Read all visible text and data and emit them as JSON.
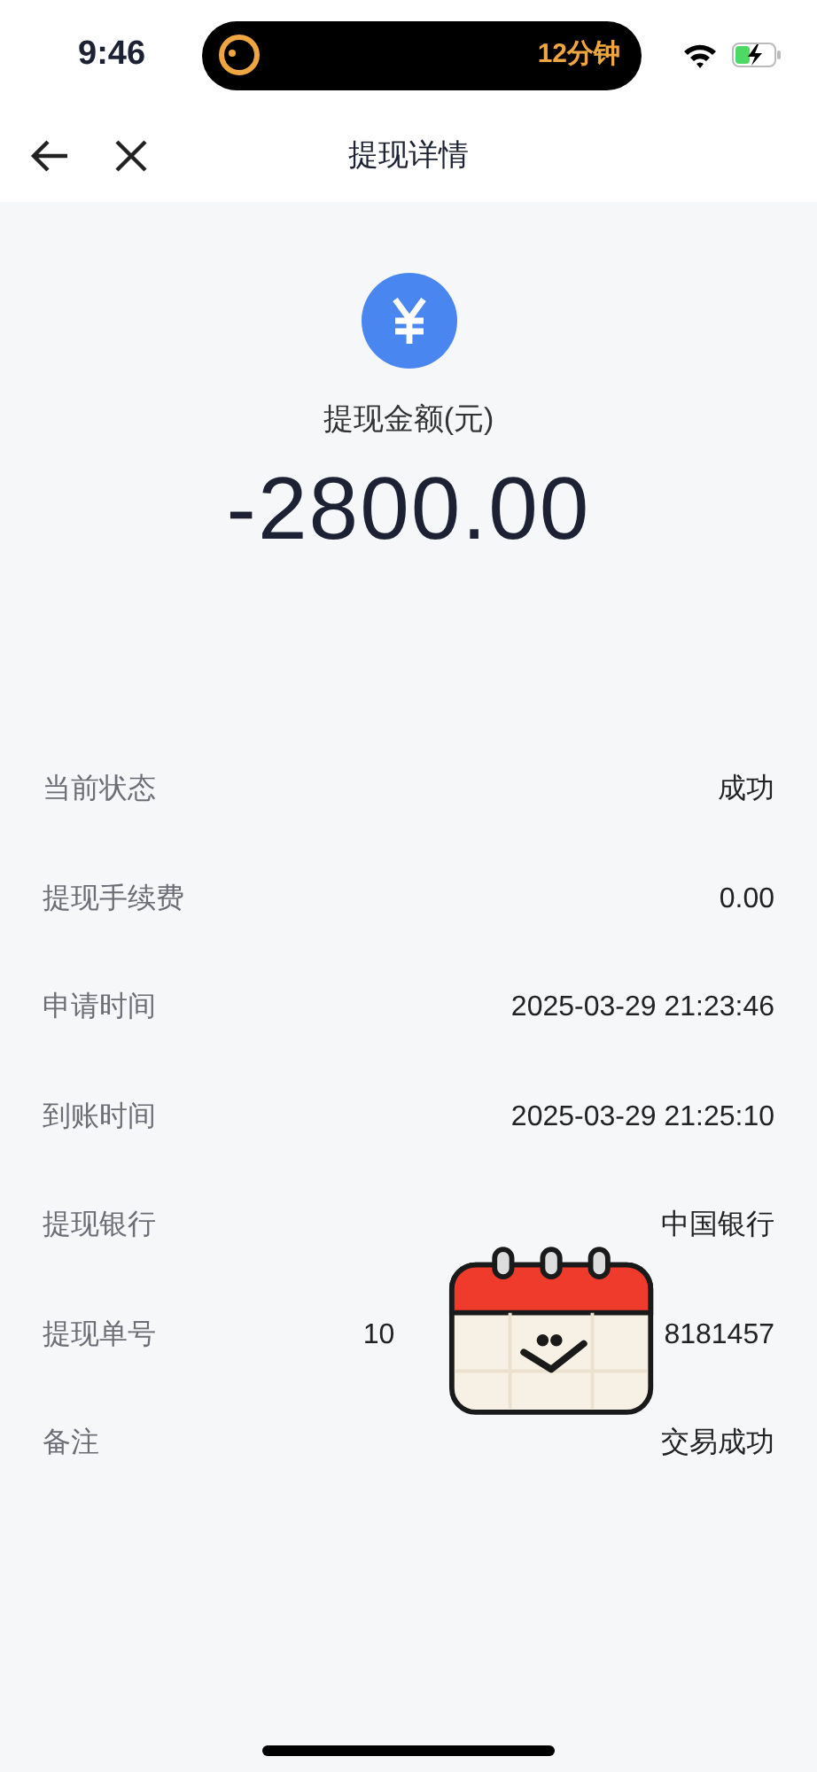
{
  "status_bar": {
    "time": "9:46",
    "island_text": "12分钟"
  },
  "nav": {
    "title": "提现详情"
  },
  "summary": {
    "label": "提现金额(元)",
    "amount": "-2800.00"
  },
  "details": [
    {
      "label": "当前状态",
      "value": [
        "成功"
      ]
    },
    {
      "label": "提现手续费",
      "value": [
        "0.00"
      ]
    },
    {
      "label": "申请时间",
      "value": [
        "2025-03-29 21:23:46"
      ]
    },
    {
      "label": "到账时间",
      "value": [
        "2025-03-29 21:25:10"
      ]
    },
    {
      "label": "提现银行",
      "value": [
        "中国银行"
      ]
    },
    {
      "label": "提现单号",
      "value": [
        "10",
        "8181457"
      ],
      "covered": true
    },
    {
      "label": "备注",
      "value": [
        "交易成功"
      ]
    }
  ]
}
